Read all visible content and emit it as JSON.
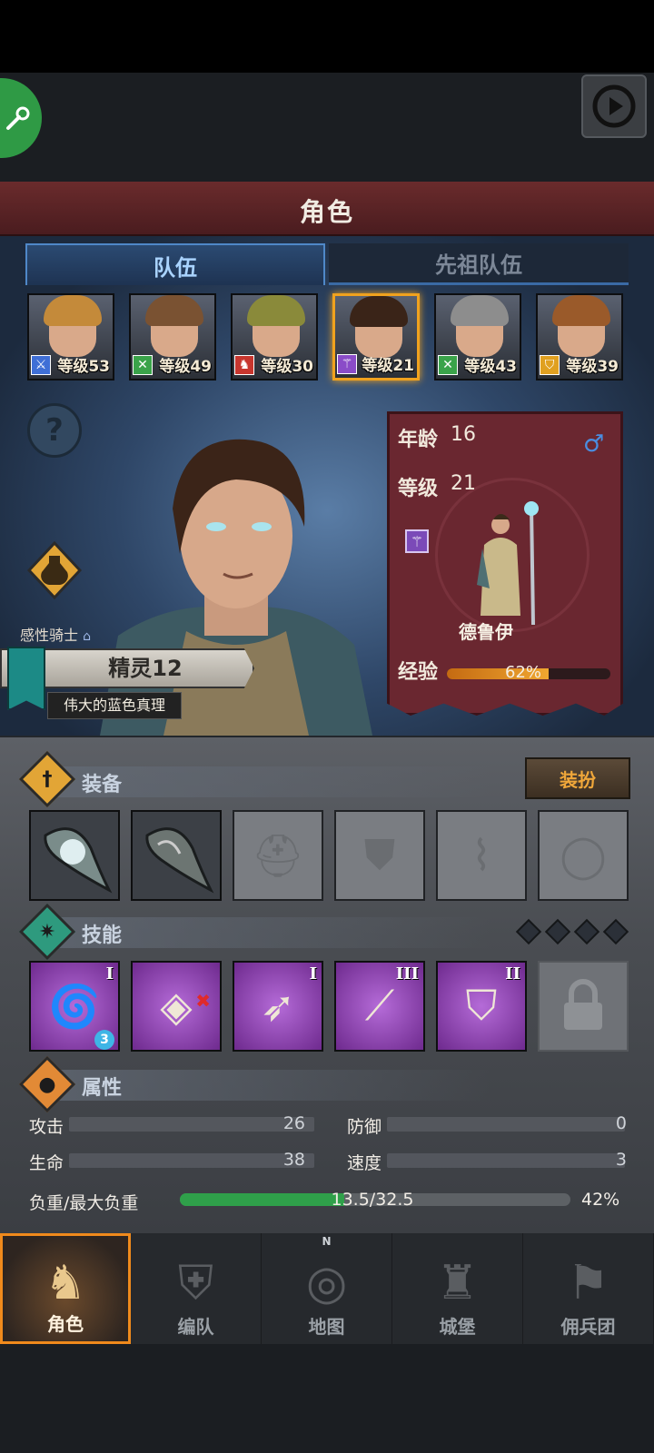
{
  "header": {
    "title": "角色"
  },
  "tabs": [
    {
      "label": "队伍",
      "active": true
    },
    {
      "label": "先祖队伍",
      "active": false
    }
  ],
  "party": [
    {
      "level": "等级53",
      "class_icon": "sword-icon",
      "class_color": "#3f6fd6",
      "hair": "#c48a3a"
    },
    {
      "level": "等级49",
      "class_icon": "crossed-arrows-icon",
      "class_color": "#3aa34a",
      "hair": "#7a5232"
    },
    {
      "level": "等级30",
      "class_icon": "horse-icon",
      "class_color": "#c8362e",
      "hair": "#8a8a3a"
    },
    {
      "level": "等级21",
      "class_icon": "staff-icon",
      "class_color": "#8a4cc8",
      "hair": "#3a2418",
      "selected": true
    },
    {
      "level": "等级43",
      "class_icon": "crossed-arrows-icon",
      "class_color": "#3aa34a",
      "hair": "#8d8d8d"
    },
    {
      "level": "等级39",
      "class_icon": "shield-icon",
      "class_color": "#e0a020",
      "hair": "#9a5a2a"
    }
  ],
  "hero": {
    "trait": "感性骑士",
    "race": "精灵12",
    "virtue": "伟大的蓝色真理"
  },
  "card": {
    "age_label": "年龄",
    "age_value": "16",
    "level_label": "等级",
    "level_value": "21",
    "gender_symbol": "♂",
    "class_name": "德鲁伊",
    "xp_label": "经验",
    "xp_percent": "62%",
    "xp_fraction": 0.62
  },
  "equipment": {
    "title": "装备",
    "outfit_button": "装扮",
    "slots": [
      {
        "name": "amulet-slot-1",
        "filled": true
      },
      {
        "name": "amulet-slot-2",
        "filled": true
      },
      {
        "name": "helmet-slot",
        "filled": false
      },
      {
        "name": "armor-slot",
        "filled": false
      },
      {
        "name": "boots-slot",
        "filled": false
      },
      {
        "name": "ring-slot",
        "filled": false
      }
    ]
  },
  "skills": {
    "title": "技能",
    "items": [
      {
        "name": "tornado-skill",
        "rank": "I",
        "stack": "3"
      },
      {
        "name": "crystal-skill",
        "rank": "",
        "stack": ""
      },
      {
        "name": "leaf-spear-skill",
        "rank": "I",
        "stack": ""
      },
      {
        "name": "spear-skill",
        "rank": "III",
        "stack": ""
      },
      {
        "name": "shield-skill",
        "rank": "II",
        "stack": ""
      }
    ]
  },
  "attributes": {
    "title": "属性",
    "attack_label": "攻击",
    "attack_value": "26",
    "defense_label": "防御",
    "defense_value": "0",
    "hp_label": "生命",
    "hp_value": "38",
    "speed_label": "速度",
    "speed_value": "3",
    "load_label": "负重/最大负重",
    "load_value": "13.5/32.5",
    "load_percent": "42%",
    "load_fraction": 0.42
  },
  "nav": [
    {
      "label": "角色",
      "active": true,
      "icon": "knight-icon"
    },
    {
      "label": "编队",
      "active": false,
      "icon": "formation-icon"
    },
    {
      "label": "地图",
      "active": false,
      "icon": "compass-map-icon"
    },
    {
      "label": "城堡",
      "active": false,
      "icon": "castle-icon"
    },
    {
      "label": "佣兵团",
      "active": false,
      "icon": "mercenary-icon"
    }
  ],
  "colors": {
    "accent": "#f08a1c",
    "xp": "#f0a730",
    "load": "#2fa04a"
  }
}
